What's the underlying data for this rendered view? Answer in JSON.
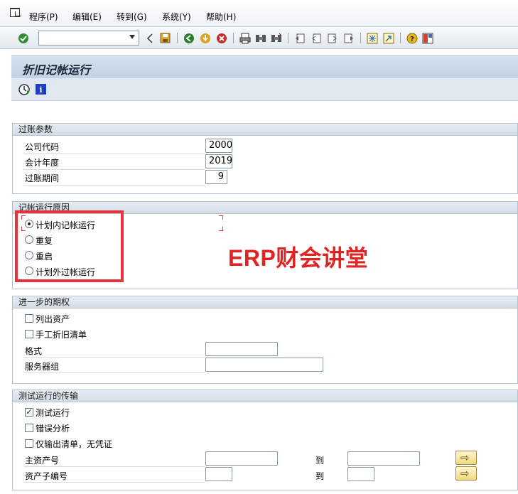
{
  "menu": {
    "items": [
      "程序(P)",
      "编辑(E)",
      "转到(G)",
      "系统(Y)",
      "帮助(H)"
    ]
  },
  "toolbar": {
    "command_value": "",
    "icons": [
      "check-icon",
      "dropdown-icon",
      "back-arrow-icon",
      "save-icon",
      "green-back-icon",
      "exit-icon",
      "cancel-icon",
      "print-icon",
      "find-icon",
      "find-next-icon",
      "first-page-icon",
      "prev-page-icon",
      "next-page-icon",
      "last-page-icon",
      "new-session-icon",
      "shortcut-icon",
      "help-icon",
      "layout-icon"
    ]
  },
  "page": {
    "title": "折旧记帐运行"
  },
  "posting_params": {
    "header": "过账参数",
    "company_code_label": "公司代码",
    "company_code": "2000",
    "fiscal_year_label": "会计年度",
    "fiscal_year": "2019",
    "period_label": "过账期间",
    "period": "9"
  },
  "reason": {
    "header": "记帐运行原因",
    "options": [
      "计划内记帐运行",
      "重复",
      "重启",
      "计划外过帐运行"
    ],
    "selected": "计划内记帐运行"
  },
  "further_options": {
    "header": "进一步的期权",
    "list_assets_label": "列出资产",
    "list_assets_checked": false,
    "manual_dep_label": "手工折旧清单",
    "manual_dep_checked": false,
    "format_label": "格式",
    "format_value": "",
    "server_group_label": "服务器组",
    "server_group_value": ""
  },
  "test_run": {
    "header": "测试运行的传输",
    "test_run_label": "测试运行",
    "test_run_checked": true,
    "error_analysis_label": "错误分析",
    "error_analysis_checked": false,
    "output_only_label": "仅输出清单，无凭证",
    "output_only_checked": false,
    "main_asset_label": "主资产号",
    "main_asset_from": "",
    "main_asset_to": "",
    "sub_asset_label": "资产子编号",
    "sub_asset_from": "",
    "sub_asset_to": "",
    "to_label": "到"
  },
  "watermark": {
    "text": "ERP财会讲堂"
  },
  "colors": {
    "highlight_box": "#e8333f",
    "watermark": "#e02424",
    "title_bar": "#c8d9e8"
  }
}
